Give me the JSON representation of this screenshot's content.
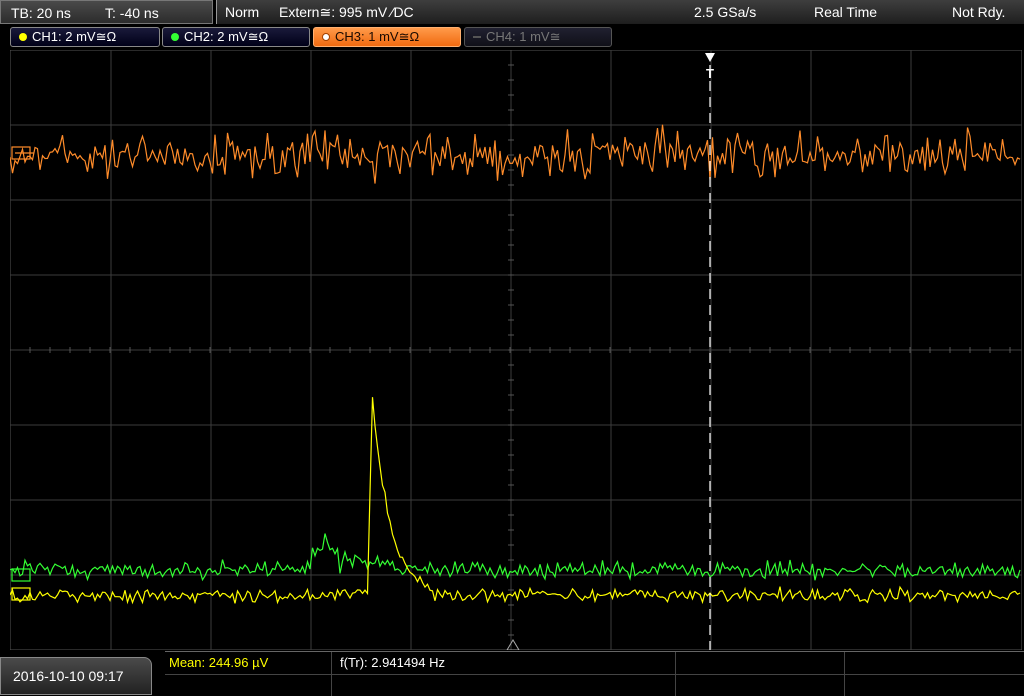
{
  "header": {
    "timebase": "TB: 20 ns",
    "trigger_time": "T: -40 ns",
    "mode": "Norm",
    "trigger_source": "Extern≅: 995 mV ⁄DC",
    "sample_rate": "2.5 GSa/s",
    "acq_mode": "Real Time",
    "status": "Not Rdy."
  },
  "channels": [
    {
      "label": "CH1: 2 mV≅Ω",
      "color": "#ffff00",
      "state": "on"
    },
    {
      "label": "CH2: 2 mV≅Ω",
      "color": "#33ff33",
      "state": "on"
    },
    {
      "label": "CH3: 1 mV≅Ω",
      "color": "#ff8c2a",
      "state": "active"
    },
    {
      "label": "CH4: 1 mV≅",
      "color": "#777777",
      "state": "off"
    }
  ],
  "trigger_marker": "T",
  "footer": {
    "datetime": "2016-10-10 09:17",
    "mean": "Mean: 244.96 µV",
    "frequency": "f(Tr): 2.941494 Hz"
  },
  "colors": {
    "ch1": "#ffff00",
    "ch2": "#33ff33",
    "ch3": "#ff8c2a",
    "grid": "#3c3c3c"
  }
}
